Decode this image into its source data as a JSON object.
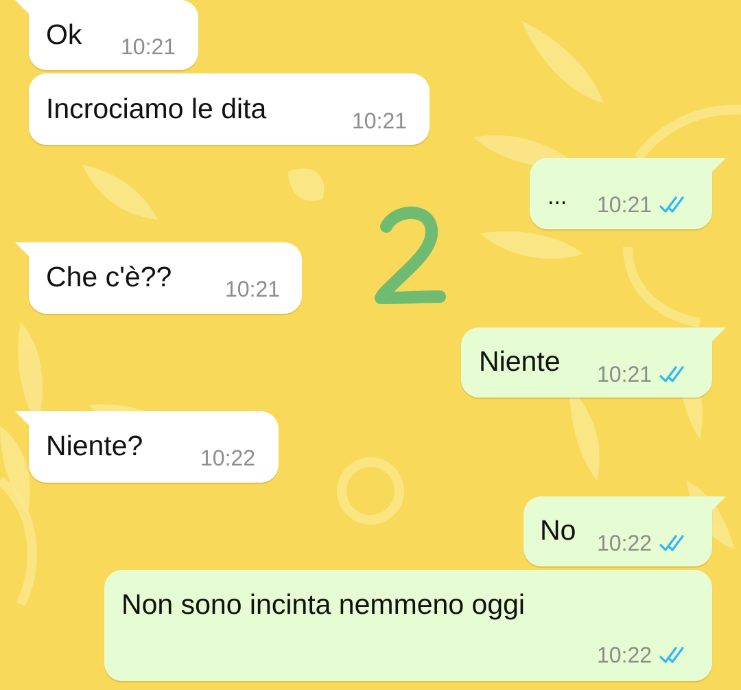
{
  "chat": {
    "theme": {
      "wallpaper_color": "#f8d95a",
      "incoming_bubble": "#ffffff",
      "outgoing_bubble": "#e6fcd3",
      "time_color": "#8d8d8d",
      "read_ticks_color": "#34b7f1"
    },
    "messages": [
      {
        "id": "m1",
        "direction": "incoming",
        "text": "Ok",
        "time": "10:21"
      },
      {
        "id": "m2",
        "direction": "incoming",
        "text": "Incrociamo le dita",
        "time": "10:21"
      },
      {
        "id": "m3",
        "direction": "outgoing",
        "text": "...",
        "time": "10:21",
        "status": "read"
      },
      {
        "id": "m4",
        "direction": "incoming",
        "text": "Che c'è??",
        "time": "10:21"
      },
      {
        "id": "m5",
        "direction": "outgoing",
        "text": "Niente",
        "time": "10:21",
        "status": "read"
      },
      {
        "id": "m6",
        "direction": "incoming",
        "text": "Niente?",
        "time": "10:22"
      },
      {
        "id": "m7",
        "direction": "outgoing",
        "text": "No",
        "time": "10:22",
        "status": "read"
      },
      {
        "id": "m8",
        "direction": "outgoing",
        "text": "Non sono incinta nemmeno oggi",
        "time": "10:22",
        "status": "read"
      }
    ]
  },
  "overlay": {
    "label": "2",
    "color": "#6fbb72"
  }
}
